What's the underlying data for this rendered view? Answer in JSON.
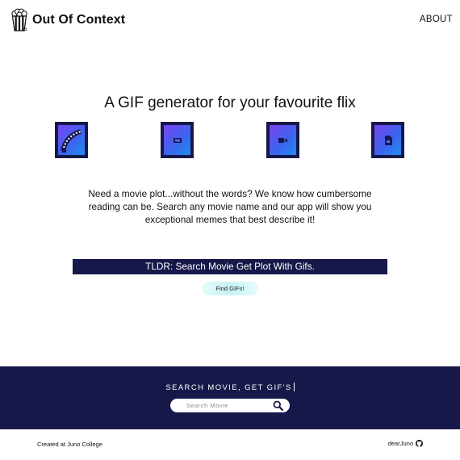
{
  "header": {
    "title": "Out Of Context",
    "logo_icon": "popcorn-icon",
    "nav": {
      "about_label": "ABOUT"
    }
  },
  "hero": {
    "headline": "A GIF generator for your favourite flix",
    "features": [
      {
        "icon": "film-reel-icon"
      },
      {
        "icon": "ticket-icon"
      },
      {
        "icon": "video-camera-icon"
      },
      {
        "icon": "movie-file-icon"
      }
    ],
    "intro": "Need a movie plot...without the words? We know how cumbersome reading can be. Search any movie name and our app will show you exceptional memes that best describe it!",
    "tldr": "TLDR: Search Movie Get Plot With Gifs.",
    "find_button_label": "Find GIFs!"
  },
  "search": {
    "title": "SEARCH MOVIE, GET GIF'S",
    "placeholder": "Search Movie",
    "value": "",
    "button_icon": "search-icon"
  },
  "footer": {
    "credit": "Created at Juno College",
    "author": "dearJuno",
    "author_icon": "github-icon"
  },
  "colors": {
    "navy": "#17184a",
    "icon_gradient_start": "#7a44f2",
    "icon_gradient_end": "#1e8cf0",
    "button_cyan": "#c7f2f4"
  }
}
